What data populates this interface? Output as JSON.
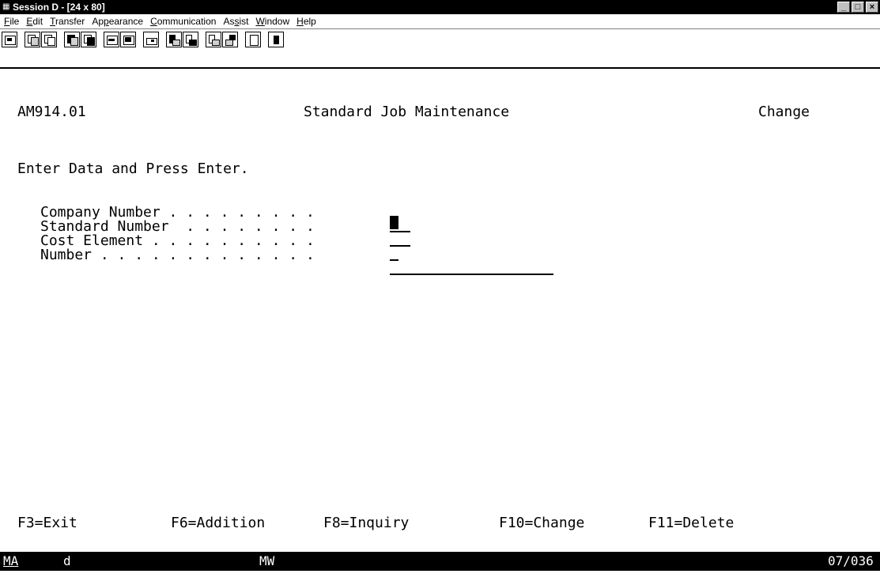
{
  "window": {
    "title": "Session D - [24 x 80]",
    "buttons": {
      "minimize": "_",
      "maximize": "□",
      "close": "×"
    }
  },
  "menu": [
    {
      "pre": "",
      "key": "F",
      "post": "ile"
    },
    {
      "pre": "",
      "key": "E",
      "post": "dit"
    },
    {
      "pre": "",
      "key": "T",
      "post": "ransfer"
    },
    {
      "pre": "Ap",
      "key": "p",
      "post": "earance"
    },
    {
      "pre": "",
      "key": "C",
      "post": "ommunication"
    },
    {
      "pre": "As",
      "key": "s",
      "post": "ist"
    },
    {
      "pre": "",
      "key": "W",
      "post": "indow"
    },
    {
      "pre": "",
      "key": "H",
      "post": "elp"
    }
  ],
  "toolbar": {
    "icons": [
      "session-icon",
      "copy-icon",
      "paste-icon",
      "send-file-icon",
      "receive-file-icon",
      "keyboard-map-icon",
      "display-setup-icon",
      "print-screen-icon",
      "record-macro-icon",
      "play-macro-icon",
      "run-macro-icon",
      "stop-macro-icon",
      "clipboard-icon",
      "help-icon"
    ]
  },
  "screen": {
    "program_id": "AM914.01",
    "title": "Standard Job Maintenance",
    "mode": "Change",
    "instruction": "Enter Data and Press Enter.",
    "fields": [
      {
        "label": "Company Number . . . . . . . . .",
        "value": ""
      },
      {
        "label": "Standard Number  . . . . . . . .",
        "value": ""
      },
      {
        "label": "Cost Element . . . . . . . . . .",
        "value": ""
      },
      {
        "label": "Number . . . . . . . . . . . . .",
        "value": ""
      }
    ],
    "function_keys": [
      "F3=Exit",
      "F6=Addition",
      "F8=Inquiry",
      "F10=Change",
      "F11=Delete"
    ]
  },
  "status": {
    "indicator": "MA",
    "field1": "d",
    "field2": "MW",
    "cursor_position": "07/036"
  }
}
